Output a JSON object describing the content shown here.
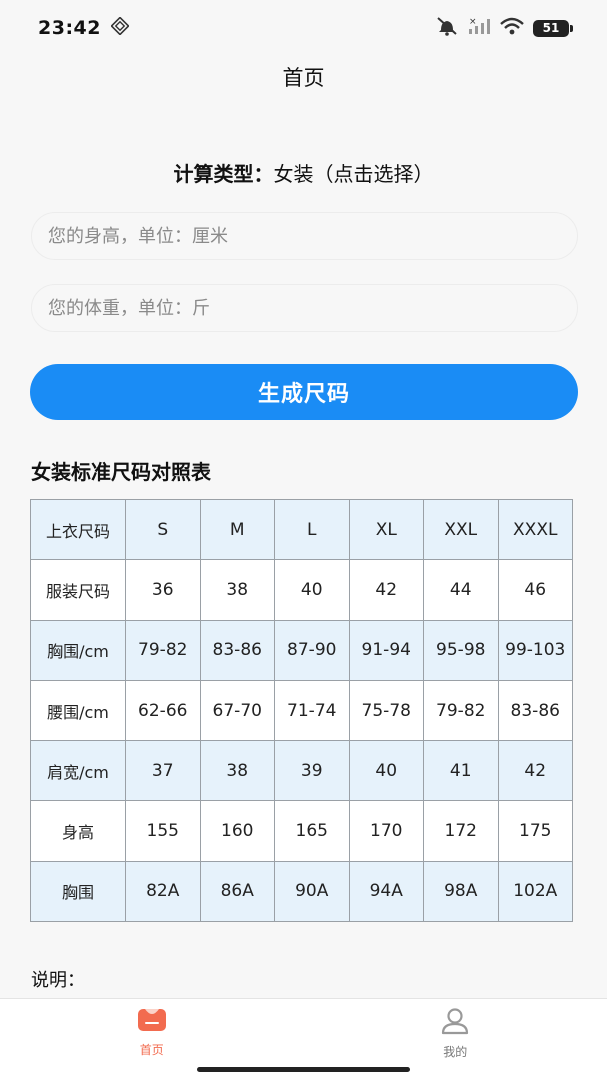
{
  "status_bar": {
    "time": "23:42",
    "battery": "51"
  },
  "nav": {
    "title": "首页"
  },
  "calc_type": {
    "label": "计算类型：",
    "value": "女装（点击选择）"
  },
  "inputs": {
    "height_placeholder": "您的身高，单位：厘米",
    "weight_placeholder": "您的体重，单位：斤"
  },
  "generate_button": "生成尺码",
  "table_title": "女装标准尺码对照表",
  "size_table": {
    "rows": [
      [
        "上衣尺码",
        "S",
        "M",
        "L",
        "XL",
        "XXL",
        "XXXL"
      ],
      [
        "服装尺码",
        "36",
        "38",
        "40",
        "42",
        "44",
        "46"
      ],
      [
        "胸围/cm",
        "79-82",
        "83-86",
        "87-90",
        "91-94",
        "95-98",
        "99-103"
      ],
      [
        "腰围/cm",
        "62-66",
        "67-70",
        "71-74",
        "75-78",
        "79-82",
        "83-86"
      ],
      [
        "肩宽/cm",
        "37",
        "38",
        "39",
        "40",
        "41",
        "42"
      ],
      [
        "身高",
        "155",
        "160",
        "165",
        "170",
        "172",
        "175"
      ],
      [
        "胸围",
        "82A",
        "86A",
        "90A",
        "94A",
        "98A",
        "102A"
      ]
    ]
  },
  "note_label": "说明：",
  "tab_bar": {
    "items": [
      {
        "label": "首页",
        "icon": "home-icon",
        "active": true
      },
      {
        "label": "我的",
        "icon": "person-icon",
        "active": false
      }
    ]
  },
  "colors": {
    "accent": "#1a8cf5",
    "tab_active": "#f26b4f",
    "table_stripe": "#e6f2fb"
  }
}
